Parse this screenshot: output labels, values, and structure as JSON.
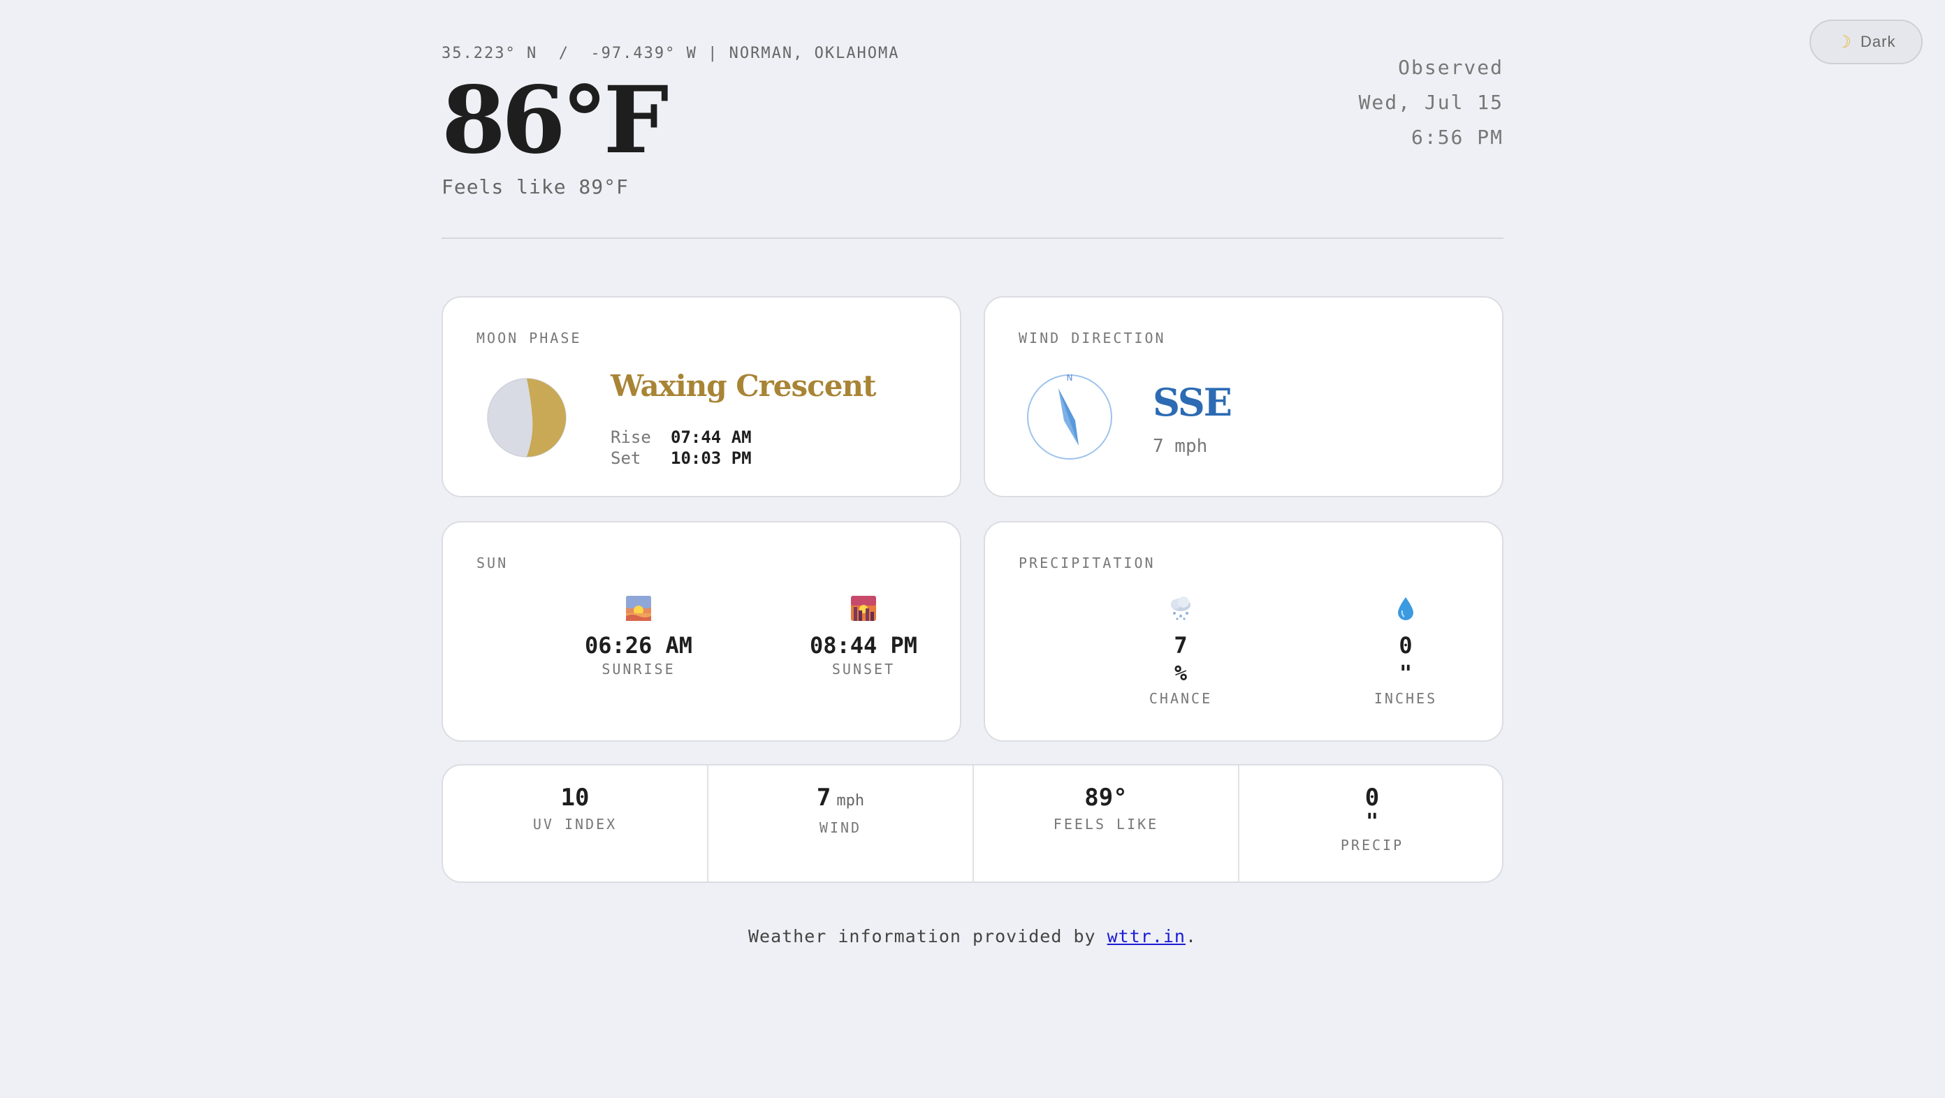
{
  "theme_toggle": {
    "icon": "moon-icon",
    "label": "Dark"
  },
  "header": {
    "coords": "35.223° N  /  -97.439° W | NORMAN, OKLAHOMA",
    "temperature": "86°F",
    "feels_like": "Feels like 89°F",
    "observed_label": "Observed",
    "observed_date": "Wed, Jul 15",
    "observed_time": "6:56 PM"
  },
  "moon": {
    "label": "MOON PHASE",
    "phase": "Waxing Crescent",
    "rise_label": "Rise",
    "rise": "07:44 AM",
    "set_label": "Set",
    "set": "10:03 PM",
    "color": "#c9a955"
  },
  "wind": {
    "label": "WIND DIRECTION",
    "compass_north": "N",
    "direction": "SSE",
    "speed": "7 mph",
    "color": "#2c6bb3"
  },
  "sun": {
    "label": "SUN",
    "sunrise": {
      "icon": "sunrise-icon",
      "time": "06:26 AM",
      "label": "SUNRISE"
    },
    "sunset": {
      "icon": "sunset-icon",
      "time": "08:44 PM",
      "label": "SUNSET"
    }
  },
  "precipitation": {
    "label": "PRECIPITATION",
    "chance": {
      "icon": "cloud-snow-icon",
      "value": "7",
      "unit": "%",
      "label": "CHANCE"
    },
    "inches": {
      "icon": "droplet-icon",
      "value": "0",
      "unit": "\"",
      "label": "INCHES"
    }
  },
  "stats": {
    "uv": {
      "value": "10",
      "label": "UV INDEX"
    },
    "wind": {
      "value": "7",
      "unit": "mph",
      "label": "WIND"
    },
    "feels": {
      "value": "89°",
      "label": "FEELS LIKE"
    },
    "precip": {
      "value": "0",
      "unit": "\"",
      "label": "PRECIP"
    }
  },
  "footer": {
    "text": "Weather information provided by ",
    "link": "wttr.in",
    "end": "."
  }
}
